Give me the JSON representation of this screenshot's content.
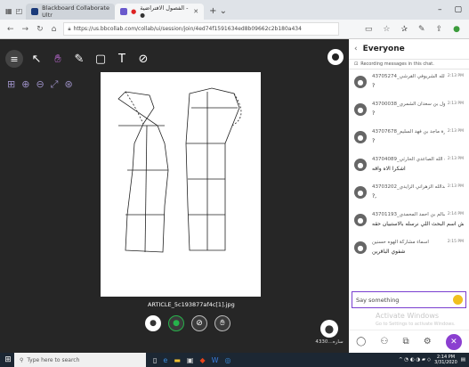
{
  "browser": {
    "tabs": [
      {
        "label": "Blackboard Collaborate Ultr",
        "active": false
      },
      {
        "label": "الفصول الافتراضية - ●",
        "active": true
      }
    ],
    "url": "https://us.bbcollab.com/collab/ui/session/join/4ed74f1591634ed8b09662c2b180a434"
  },
  "session": {
    "filename": "ARTICLE_5c193877af4c[1].jpg",
    "my_name": "4330…ساره"
  },
  "chat": {
    "title": "Everyone",
    "notice": "Recording messages in this chat.",
    "input_placeholder": "Say something",
    "watermark_title": "Activate Windows",
    "watermark_sub": "Go to Settings to activate Windows.",
    "messages": [
      {
        "sender": "43705274_سارة عبدالله الشريوفي القرشي",
        "time": "2:13 PM",
        "body": "?"
      },
      {
        "sender": "43700038_نورة نجول بن سعدان الشمري",
        "time": "2:13 PM",
        "body": "?"
      },
      {
        "sender": "43707678_سارة ماجد بن فهد السليم",
        "time": "2:13 PM",
        "body": "?"
      },
      {
        "sender": "43704089_روان ذياب الله الصاعدي الحارثي",
        "time": "2:13 PM",
        "body": "اشكرا الاه واقه"
      },
      {
        "sender": "43703202_فاطمة بنت عبدالله الزهراني الزايدي",
        "time": "2:13 PM",
        "body": "?,"
      },
      {
        "sender": "43701193_سارة سالم بن احمد المحمدي",
        "time": "2:14 PM",
        "body": "دكتوره ايش اسم البحث اللي نرسله بالاستبيان حقه"
      },
      {
        "sender": "اسماء مشاركة الهوه حسنين",
        "time": "2:15 PM",
        "body": "شفوي الباقرين"
      }
    ]
  },
  "taskbar": {
    "search_placeholder": "Type here to search",
    "time": "2:14 PM",
    "date": "3/31/2020"
  }
}
